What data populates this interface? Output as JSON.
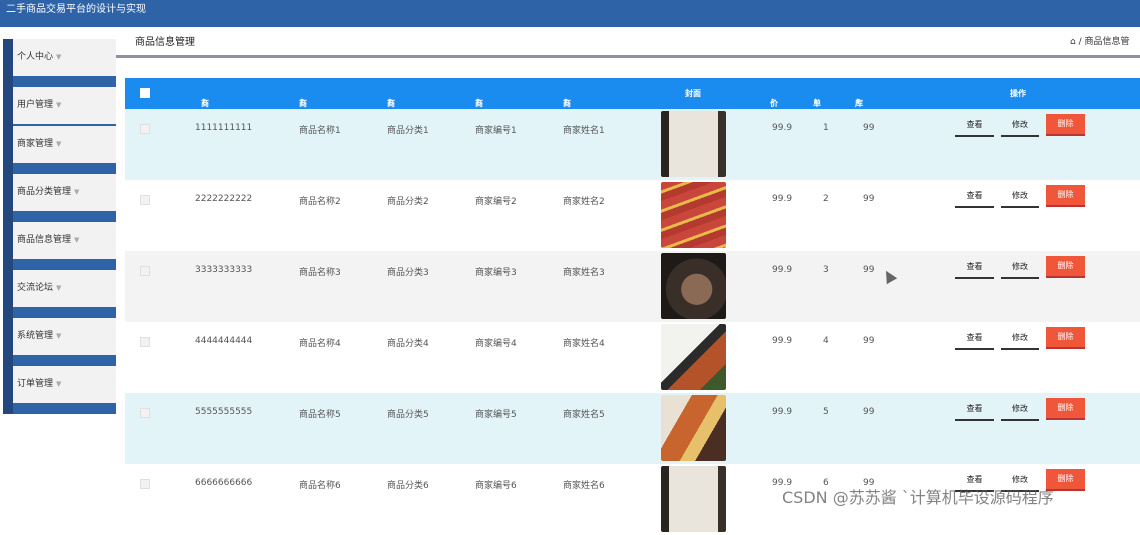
{
  "app": {
    "title": "二手商品交易平台的设计与实现"
  },
  "sidebar": {
    "items": [
      {
        "label": "个人中心"
      },
      {
        "label": "用户管理"
      },
      {
        "label": "商家管理"
      },
      {
        "label": "商品分类管理"
      },
      {
        "label": "商品信息管理"
      },
      {
        "label": "交流论坛"
      },
      {
        "label": "系统管理"
      },
      {
        "label": "订单管理"
      }
    ]
  },
  "header": {
    "title": "商品信息管理",
    "breadcrumb": "/ 商品信息管"
  },
  "table": {
    "columns": [
      "商品编号",
      "商品名称",
      "商品分类",
      "商家编号",
      "商家姓名",
      "封面",
      "价格",
      "单限",
      "库存",
      "操作"
    ],
    "actions": {
      "view": "查看",
      "edit": "修改",
      "delete": "删除"
    },
    "rows": [
      {
        "id": "1111111111",
        "name": "商品名称1",
        "category": "商品分类1",
        "merchant_id": "商家编号1",
        "merchant_name": "商家姓名1",
        "price": "99.9",
        "limit": "1",
        "stock": "99",
        "cover": "white-blouse-photo"
      },
      {
        "id": "2222222222",
        "name": "商品名称2",
        "category": "商品分类2",
        "merchant_id": "商家编号2",
        "merchant_name": "商家姓名2",
        "price": "99.9",
        "limit": "2",
        "stock": "99",
        "cover": "sausages-photo"
      },
      {
        "id": "3333333333",
        "name": "商品名称3",
        "category": "商品分类3",
        "merchant_id": "商家编号3",
        "merchant_name": "商家姓名3",
        "price": "99.9",
        "limit": "3",
        "stock": "99",
        "cover": "handbag-photo"
      },
      {
        "id": "4444444444",
        "name": "商品名称4",
        "category": "商品分类4",
        "merchant_id": "商家编号4",
        "merchant_name": "商家姓名4",
        "price": "99.9",
        "limit": "4",
        "stock": "99",
        "cover": "food-box-photo"
      },
      {
        "id": "5555555555",
        "name": "商品名称5",
        "category": "商品分类5",
        "merchant_id": "商家编号5",
        "merchant_name": "商家姓名5",
        "price": "99.9",
        "limit": "5",
        "stock": "99",
        "cover": "bento-photo"
      },
      {
        "id": "6666666666",
        "name": "商品名称6",
        "category": "商品分类6",
        "merchant_id": "商家编号6",
        "merchant_name": "商家姓名6",
        "price": "99.9",
        "limit": "6",
        "stock": "99",
        "cover": "white-blouse-photo"
      }
    ]
  },
  "watermark": "CSDN @苏苏酱 `计算机毕设源码程序",
  "colors": {
    "topbar": "#2f63a8",
    "sidebar_bar": "#24487e",
    "table_header": "#1a8cf0",
    "row_tint": "#e3f4f9",
    "row_alt": "#f3f3f3",
    "delete": "#f0563a"
  }
}
